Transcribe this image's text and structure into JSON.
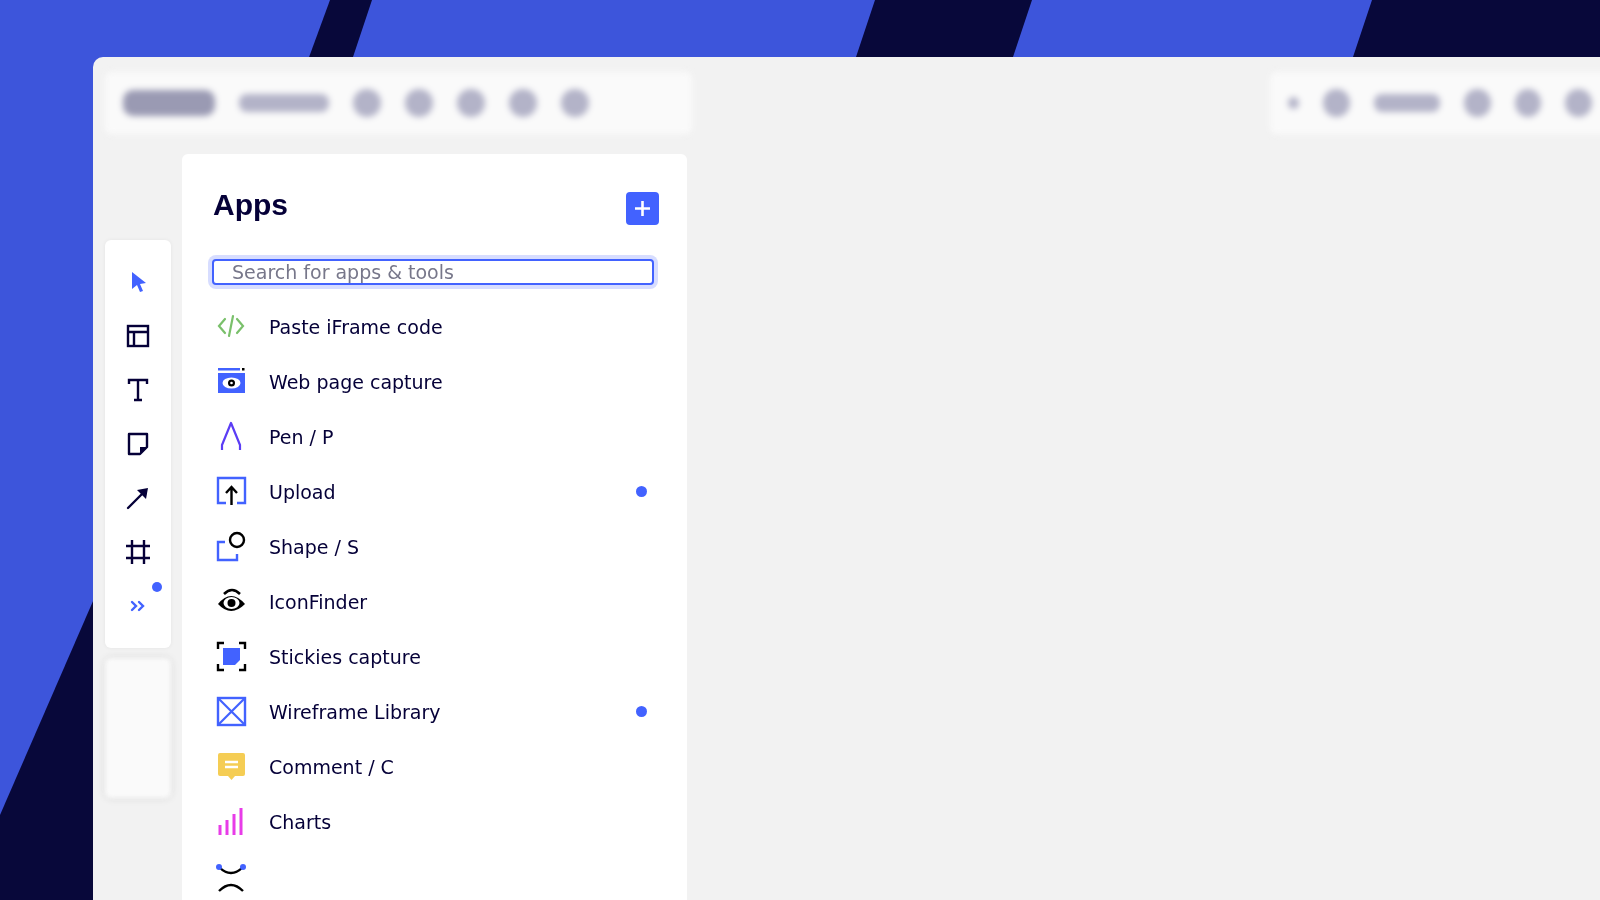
{
  "tools": [
    {
      "kind": "select",
      "selected": true
    },
    {
      "kind": "template",
      "selected": false
    },
    {
      "kind": "text",
      "selected": false
    },
    {
      "kind": "sticky",
      "selected": false
    },
    {
      "kind": "arrow",
      "selected": false
    },
    {
      "kind": "frame",
      "selected": false
    },
    {
      "kind": "more",
      "badge": true
    }
  ],
  "panel": {
    "title": "Apps",
    "search": {
      "placeholder": "Search for apps & tools"
    },
    "items": [
      {
        "kind": "code",
        "label": "Paste iFrame code",
        "new_dot": false
      },
      {
        "kind": "webcapture",
        "label": "Web page capture",
        "new_dot": false
      },
      {
        "kind": "pen",
        "label": "Pen / P",
        "new_dot": false
      },
      {
        "kind": "upload",
        "label": "Upload",
        "new_dot": true
      },
      {
        "kind": "shape",
        "label": "Shape / S",
        "new_dot": false
      },
      {
        "kind": "iconfinder",
        "label": "IconFinder",
        "new_dot": false
      },
      {
        "kind": "stickies",
        "label": "Stickies capture",
        "new_dot": false
      },
      {
        "kind": "wireframe",
        "label": "Wireframe Library",
        "new_dot": true
      },
      {
        "kind": "comment",
        "label": "Comment / C",
        "new_dot": false
      },
      {
        "kind": "charts",
        "label": "Charts",
        "new_dot": false
      },
      {
        "kind": "mindmap"
      }
    ]
  }
}
